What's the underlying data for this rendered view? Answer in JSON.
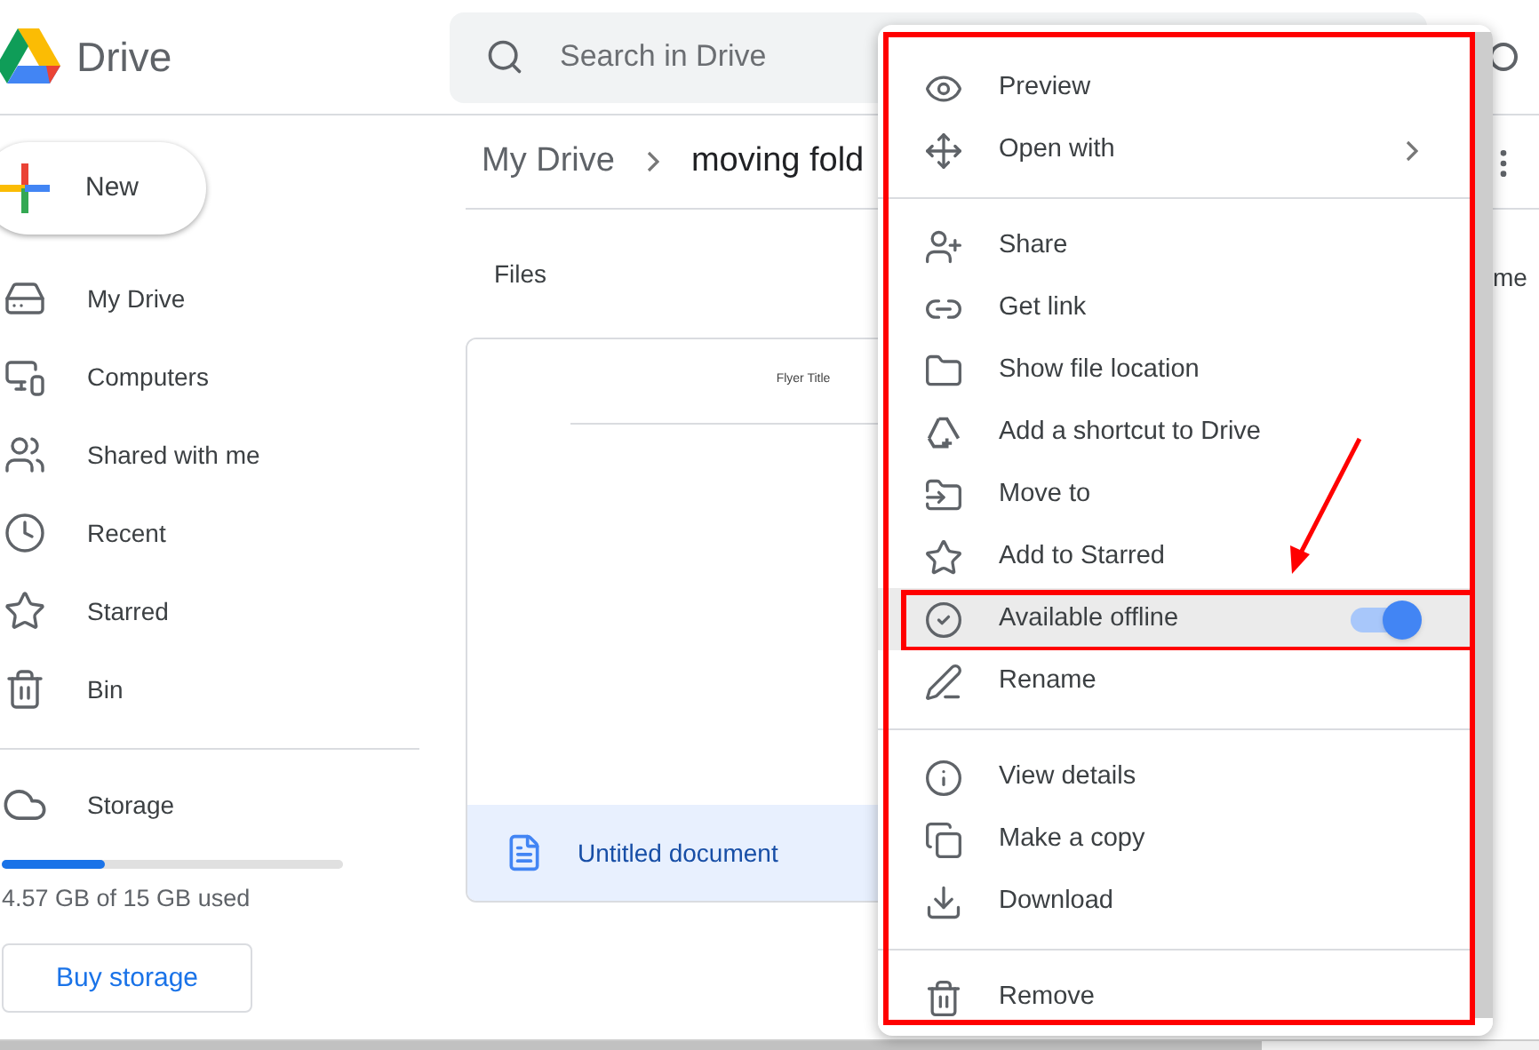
{
  "app": {
    "name": "Drive"
  },
  "search": {
    "placeholder": "Search in Drive"
  },
  "new_button": {
    "label": "New"
  },
  "sidebar": {
    "items": [
      {
        "label": "My Drive",
        "selected": false
      },
      {
        "label": "Computers",
        "selected": false
      },
      {
        "label": "Shared with me",
        "selected": false
      },
      {
        "label": "Recent",
        "selected": false
      },
      {
        "label": "Starred",
        "selected": false
      },
      {
        "label": "Bin",
        "selected": false
      }
    ]
  },
  "storage": {
    "label": "Storage",
    "level": 0.3,
    "usage": "4.57 GB of 15 GB used",
    "button": "Buy storage"
  },
  "breadcrumb": [
    "My Drive",
    "moving fold"
  ],
  "files_heading": "Files",
  "column_2": "me",
  "file_card": {
    "preview_title": "Flyer Title",
    "name": "Untitled document"
  },
  "context_menu": {
    "items": [
      {
        "kind": "item",
        "label": "Preview",
        "highlighted": false,
        "submenu": false,
        "divider_after": false
      },
      {
        "kind": "item",
        "label": "Open with",
        "highlighted": false,
        "submenu": true,
        "divider_after": true
      },
      {
        "kind": "item",
        "label": "Share",
        "highlighted": false,
        "submenu": false,
        "divider_after": false
      },
      {
        "kind": "item",
        "label": "Get link",
        "highlighted": false,
        "submenu": false,
        "divider_after": false
      },
      {
        "kind": "item",
        "label": "Show file location",
        "highlighted": false,
        "submenu": false,
        "divider_after": false
      },
      {
        "kind": "item",
        "label": "Add a shortcut to Drive",
        "highlighted": false,
        "submenu": false,
        "divider_after": false
      },
      {
        "kind": "item",
        "label": "Move to",
        "highlighted": false,
        "submenu": false,
        "divider_after": false
      },
      {
        "kind": "item",
        "label": "Add to Starred",
        "highlighted": false,
        "submenu": false,
        "divider_after": false
      },
      {
        "kind": "toggle",
        "label": "Available offline",
        "highlighted": true,
        "on": true,
        "submenu": false,
        "divider_after": false
      },
      {
        "kind": "item",
        "label": "Rename",
        "highlighted": false,
        "submenu": false,
        "divider_after": true
      },
      {
        "kind": "item",
        "label": "View details",
        "highlighted": false,
        "submenu": false,
        "divider_after": false
      },
      {
        "kind": "item",
        "label": "Make a copy",
        "highlighted": false,
        "submenu": false,
        "divider_after": false
      },
      {
        "kind": "item",
        "label": "Download",
        "highlighted": false,
        "submenu": false,
        "divider_after": true
      },
      {
        "kind": "item",
        "label": "Remove",
        "highlighted": false,
        "submenu": false,
        "divider_after": false
      }
    ]
  }
}
